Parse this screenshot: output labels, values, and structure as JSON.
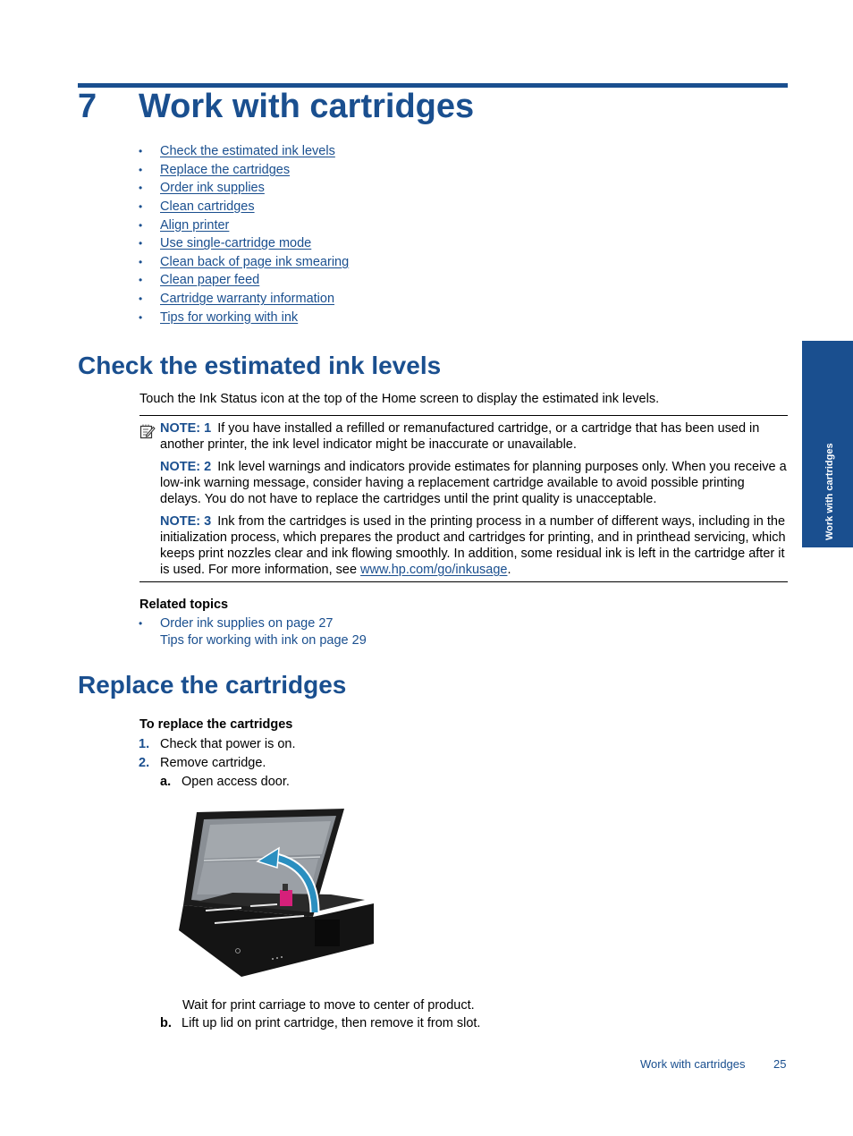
{
  "chapter": {
    "number": "7",
    "title": "Work with cartridges"
  },
  "toc": [
    {
      "label": "Check the estimated ink levels"
    },
    {
      "label": "Replace the cartridges"
    },
    {
      "label": "Order ink supplies"
    },
    {
      "label": "Clean cartridges"
    },
    {
      "label": "Align printer"
    },
    {
      "label": "Use single-cartridge mode"
    },
    {
      "label": "Clean back of page ink smearing"
    },
    {
      "label": "Clean paper feed"
    },
    {
      "label": "Cartridge warranty information"
    },
    {
      "label": "Tips for working with ink"
    }
  ],
  "side_tab": {
    "label": "Work with cartridges"
  },
  "section1": {
    "heading": "Check the estimated ink levels",
    "intro": "Touch the Ink Status icon at the top of the Home screen to display the estimated ink levels.",
    "notes": [
      {
        "label": "NOTE: 1",
        "text": "If you have installed a refilled or remanufactured cartridge, or a cartridge that has been used in another printer, the ink level indicator might be inaccurate or unavailable."
      },
      {
        "label": "NOTE: 2",
        "text": "Ink level warnings and indicators provide estimates for planning purposes only. When you receive a low-ink warning message, consider having a replacement cartridge available to avoid possible printing delays. You do not have to replace the cartridges until the print quality is unacceptable."
      },
      {
        "label": "NOTE: 3",
        "text": "Ink from the cartridges is used in the printing process in a number of different ways, including in the initialization process, which prepares the product and cartridges for printing, and in printhead servicing, which keeps print nozzles clear and ink flowing smoothly. In addition, some residual ink is left in the cartridge after it is used. For more information, see ",
        "link": "www.hp.com/go/inkusage",
        "suffix": "."
      }
    ],
    "related": {
      "title": "Related topics",
      "items": [
        {
          "label": "Order ink supplies on page 27"
        },
        {
          "label": "Tips for working with ink on page 29"
        }
      ]
    }
  },
  "section2": {
    "heading": "Replace the cartridges",
    "procedure_title": "To replace the cartridges",
    "steps": [
      {
        "num": "1.",
        "text": "Check that power is on."
      },
      {
        "num": "2.",
        "text": "Remove cartridge."
      }
    ],
    "substeps": [
      {
        "num": "a.",
        "text": "Open access door."
      },
      {
        "num": "b.",
        "text": "Lift up lid on print cartridge, then remove it from slot."
      }
    ],
    "figure_caption": "Wait for print carriage to move to center of product.",
    "colors": {
      "accent": "#1a4f8f",
      "cartridge": "#d6207a",
      "arrow": "#2a8fc0"
    }
  },
  "footer": {
    "section": "Work with cartridges",
    "page": "25"
  }
}
